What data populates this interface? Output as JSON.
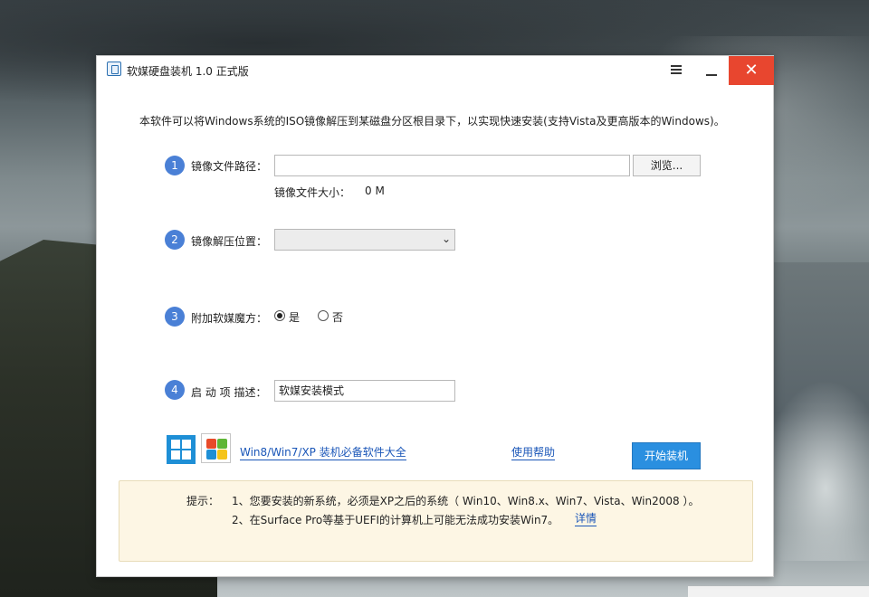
{
  "window": {
    "title": "软媒硬盘装机 1.0 正式版",
    "close_glyph": "✕"
  },
  "intro": "本软件可以将Windows系统的ISO镜像解压到某磁盘分区根目录下，以实现快速安装(支持Vista及更高版本的Windows)。",
  "steps": [
    {
      "num": "1",
      "label": "镜像文件路径："
    },
    {
      "num": "2",
      "label": "镜像解压位置："
    },
    {
      "num": "3",
      "label": "附加软媒魔方："
    },
    {
      "num": "4",
      "label": "启 动 项 描述："
    }
  ],
  "iso": {
    "path_value": "",
    "browse_label": "浏览...",
    "size_label": "镜像文件大小：",
    "size_value": "0 M"
  },
  "extract": {
    "selected": "",
    "chevron": "⌄"
  },
  "addon": {
    "yes_label": "是",
    "no_label": "否",
    "selected": "是"
  },
  "boot": {
    "description_value": "软媒安装模式"
  },
  "footer": {
    "software_link": "Win8/Win7/XP 装机必备软件大全",
    "help_link": "使用帮助",
    "start_button": "开始装机"
  },
  "tips": {
    "title": "提示：",
    "items": [
      "1、您要安装的新系统，必须是XP之后的系统（ Win10、Win8.x、Win7、Vista、Win2008 ）。",
      "2、在Surface Pro等基于UEFI的计算机上可能无法成功安装Win7。"
    ],
    "details_link": "详情"
  },
  "colors": {
    "close_red": "#e8462f",
    "accent_blue": "#2a8fe0",
    "step_blue": "#4a80d6",
    "link_blue": "#1a56b8",
    "tips_bg": "#fdf6e4"
  }
}
